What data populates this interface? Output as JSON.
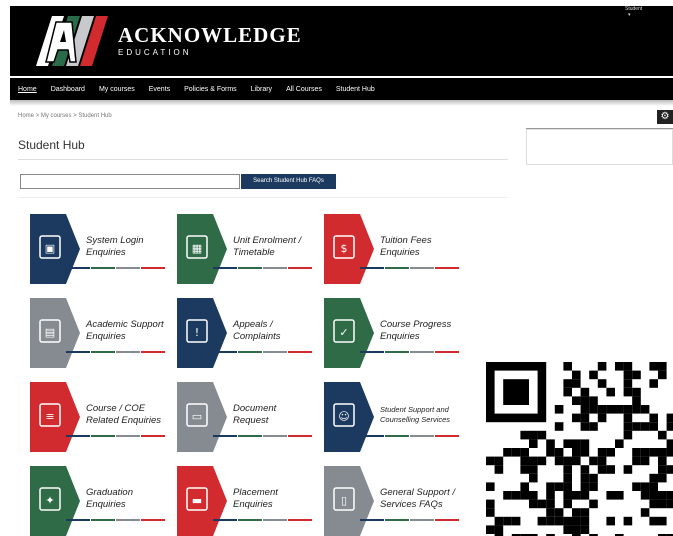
{
  "header": {
    "brand_name": "ACKNOWLEDGE",
    "brand_sub": "EDUCATION",
    "user_label": "Student"
  },
  "nav": [
    "Home",
    "Dashboard",
    "My courses",
    "Events",
    "Policies & Forms",
    "Library",
    "All Courses",
    "Student Hub"
  ],
  "breadcrumb": "Home  >  My courses  >  Student Hub",
  "page_title": "Student Hub",
  "search": {
    "button": "Search Student Hub FAQs",
    "value": ""
  },
  "colors": {
    "navy": "#1c3a60",
    "green": "#2f6b47",
    "red": "#d12a2f",
    "grey": "#858b91"
  },
  "tiles": [
    {
      "line1": "System Login",
      "line2": "Enquiries",
      "color": "navy",
      "icon": "login-screen-icon"
    },
    {
      "line1": "Unit Enrolment /",
      "line2": "Timetable",
      "color": "green",
      "icon": "calendar-icon"
    },
    {
      "line1": "Tuition Fees",
      "line2": "Enquiries",
      "color": "red",
      "icon": "money-hand-icon"
    },
    {
      "line1": "Academic Support",
      "line2": "Enquiries",
      "color": "grey",
      "icon": "book-icon"
    },
    {
      "line1": "Appeals /",
      "line2": "Complaints",
      "color": "navy",
      "icon": "alert-chat-icon"
    },
    {
      "line1": "Course Progress",
      "line2": "Enquiries",
      "color": "green",
      "icon": "progress-icon"
    },
    {
      "line1": "Course / COE",
      "line2": "Related Enquiries",
      "color": "red",
      "icon": "document-icon"
    },
    {
      "line1": "Document",
      "line2": "Request",
      "color": "grey",
      "icon": "folder-icon"
    },
    {
      "line1": "Student Support and",
      "line2": "Counselling Services",
      "color": "navy",
      "icon": "people-chat-icon",
      "small": true
    },
    {
      "line1": "Graduation",
      "line2": "Enquiries",
      "color": "green",
      "icon": "graduation-cap-icon"
    },
    {
      "line1": "Placement",
      "line2": "Enquiries",
      "color": "red",
      "icon": "briefcase-icon"
    },
    {
      "line1": "General Support /",
      "line2": "Services FAQs",
      "color": "grey",
      "icon": "files-icon"
    }
  ]
}
